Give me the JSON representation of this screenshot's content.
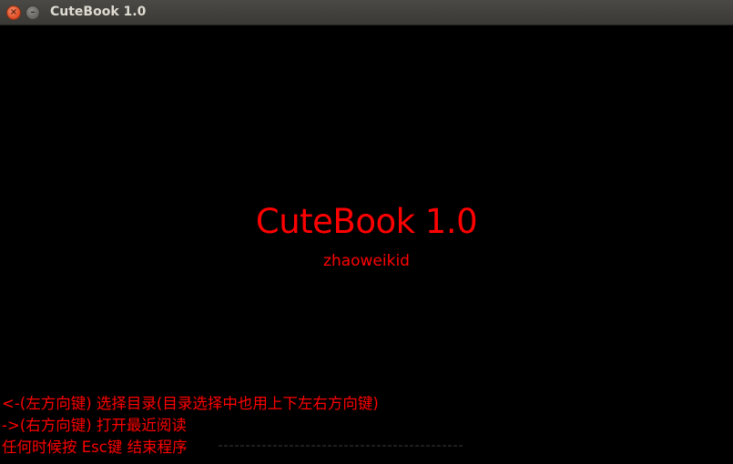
{
  "window": {
    "title": "CuteBook 1.0",
    "close_glyph": "×",
    "minimize_glyph": "–"
  },
  "splash": {
    "title": "CuteBook 1.0",
    "author": "zhaoweikid"
  },
  "help": {
    "line1": "<-(左方向键) 选择目录(目录选择中也用上下左右方向键)",
    "line2": "->(右方向键) 打开最近阅读",
    "line3": "任何时候按 Esc键 结束程序"
  },
  "colors": {
    "text": "#ff0000",
    "background": "#000000",
    "titlebar": "#3c3b37"
  }
}
